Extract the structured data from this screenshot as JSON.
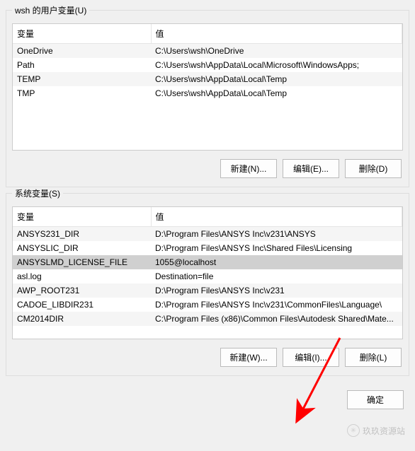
{
  "user_section": {
    "title": "wsh 的用户变量(U)",
    "columns": {
      "variable": "变量",
      "value": "值"
    },
    "rows": [
      {
        "variable": "OneDrive",
        "value": "C:\\Users\\wsh\\OneDrive"
      },
      {
        "variable": "Path",
        "value": "C:\\Users\\wsh\\AppData\\Local\\Microsoft\\WindowsApps;"
      },
      {
        "variable": "TEMP",
        "value": "C:\\Users\\wsh\\AppData\\Local\\Temp"
      },
      {
        "variable": "TMP",
        "value": "C:\\Users\\wsh\\AppData\\Local\\Temp"
      }
    ],
    "buttons": {
      "new": "新建(N)...",
      "edit": "编辑(E)...",
      "delete": "删除(D)"
    }
  },
  "system_section": {
    "title": "系统变量(S)",
    "columns": {
      "variable": "变量",
      "value": "值"
    },
    "rows": [
      {
        "variable": "ANSYS231_DIR",
        "value": "D:\\Program Files\\ANSYS Inc\\v231\\ANSYS"
      },
      {
        "variable": "ANSYSLIC_DIR",
        "value": "D:\\Program Files\\ANSYS Inc\\Shared Files\\Licensing"
      },
      {
        "variable": "ANSYSLMD_LICENSE_FILE",
        "value": "1055@localhost",
        "selected": true
      },
      {
        "variable": "asl.log",
        "value": "Destination=file"
      },
      {
        "variable": "AWP_ROOT231",
        "value": "D:\\Program Files\\ANSYS Inc\\v231"
      },
      {
        "variable": "CADOE_LIBDIR231",
        "value": "D:\\Program Files\\ANSYS Inc\\v231\\CommonFiles\\Language\\"
      },
      {
        "variable": "CM2014DIR",
        "value": "C:\\Program Files (x86)\\Common Files\\Autodesk Shared\\Mate..."
      }
    ],
    "buttons": {
      "new": "新建(W)...",
      "edit": "编辑(I)...",
      "delete": "删除(L)"
    }
  },
  "footer": {
    "ok": "确定"
  },
  "watermark": {
    "text": "玖玖资源站"
  },
  "annotation": {
    "arrow_color": "#ff0000"
  }
}
